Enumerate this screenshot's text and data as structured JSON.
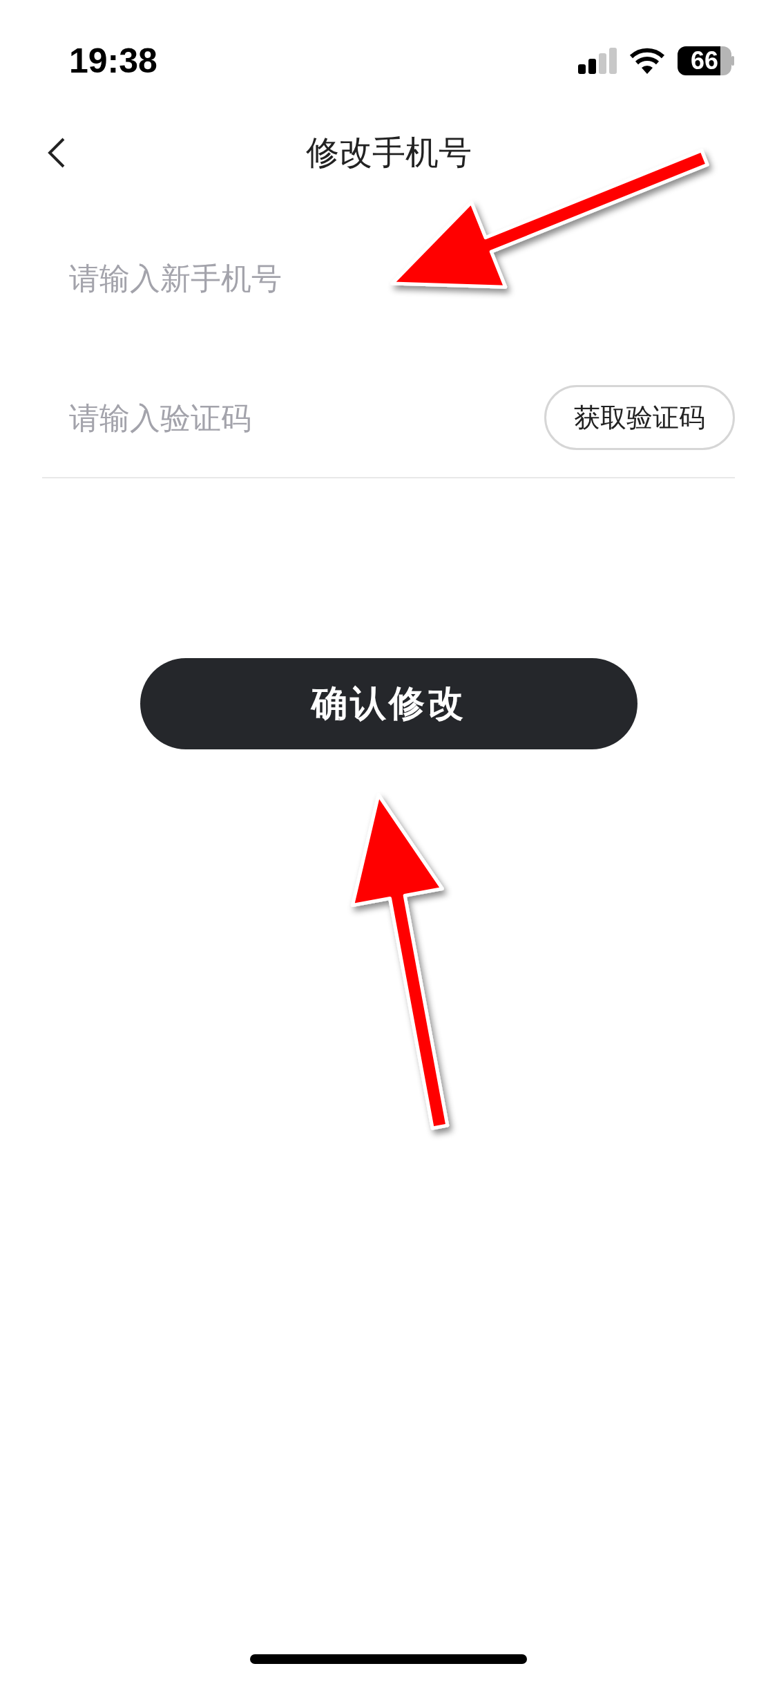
{
  "status_bar": {
    "time": "19:38",
    "battery": "66"
  },
  "nav": {
    "title": "修改手机号"
  },
  "fields": [
    {
      "kind": "text",
      "placeholder": "请输入新手机号"
    },
    {
      "kind": "code",
      "placeholder": "请输入验证码",
      "button": "获取验证码"
    }
  ],
  "confirm_button": "确认修改",
  "annotations": [
    {
      "kind": "arrow"
    },
    {
      "kind": "arrow"
    }
  ]
}
